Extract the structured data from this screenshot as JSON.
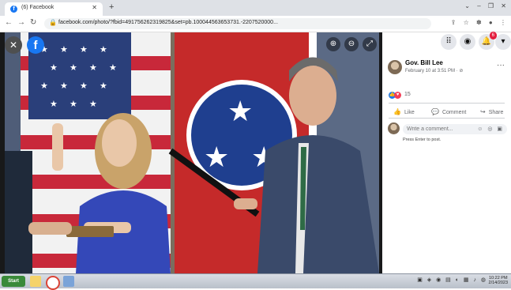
{
  "browser": {
    "tab_title": "(6) Facebook",
    "tab_icon": "f",
    "tab_close": "✕",
    "new_tab": "+",
    "url": "facebook.com/photo/?fbid=491756262319825&set=pb.100044563653731.-2207520000...",
    "win_controls": [
      "⌄",
      "–",
      "❐",
      "✕"
    ],
    "toolbar_icons": [
      "⇪",
      "☆",
      "✽",
      "●",
      "⋮"
    ]
  },
  "viewer": {
    "close": "✕",
    "logo": "f",
    "controls": [
      "⊕",
      "⊖",
      "⤢"
    ]
  },
  "sidebar": {
    "top_icons": [
      "⠿",
      "◉",
      "🔔",
      "▾"
    ],
    "notification_count": "6",
    "poster_name": "Gov. Bill Lee",
    "post_date": "February 10 at 3:51 PM · ⊘",
    "more": "···",
    "reactions_count": "15",
    "actions": {
      "like": "Like",
      "comment": "Comment",
      "share": "Share"
    },
    "comment_placeholder": "Write a comment...",
    "comment_icons": "☺ ◎ ▣",
    "hint": "Press Enter to post."
  },
  "taskbar": {
    "start": "Start",
    "time": "10:22 PM",
    "date": "2/14/2023"
  },
  "colors": {
    "facebook_blue": "#1877f2",
    "love_red": "#f33e58",
    "viewer_bg": "#18191a"
  }
}
